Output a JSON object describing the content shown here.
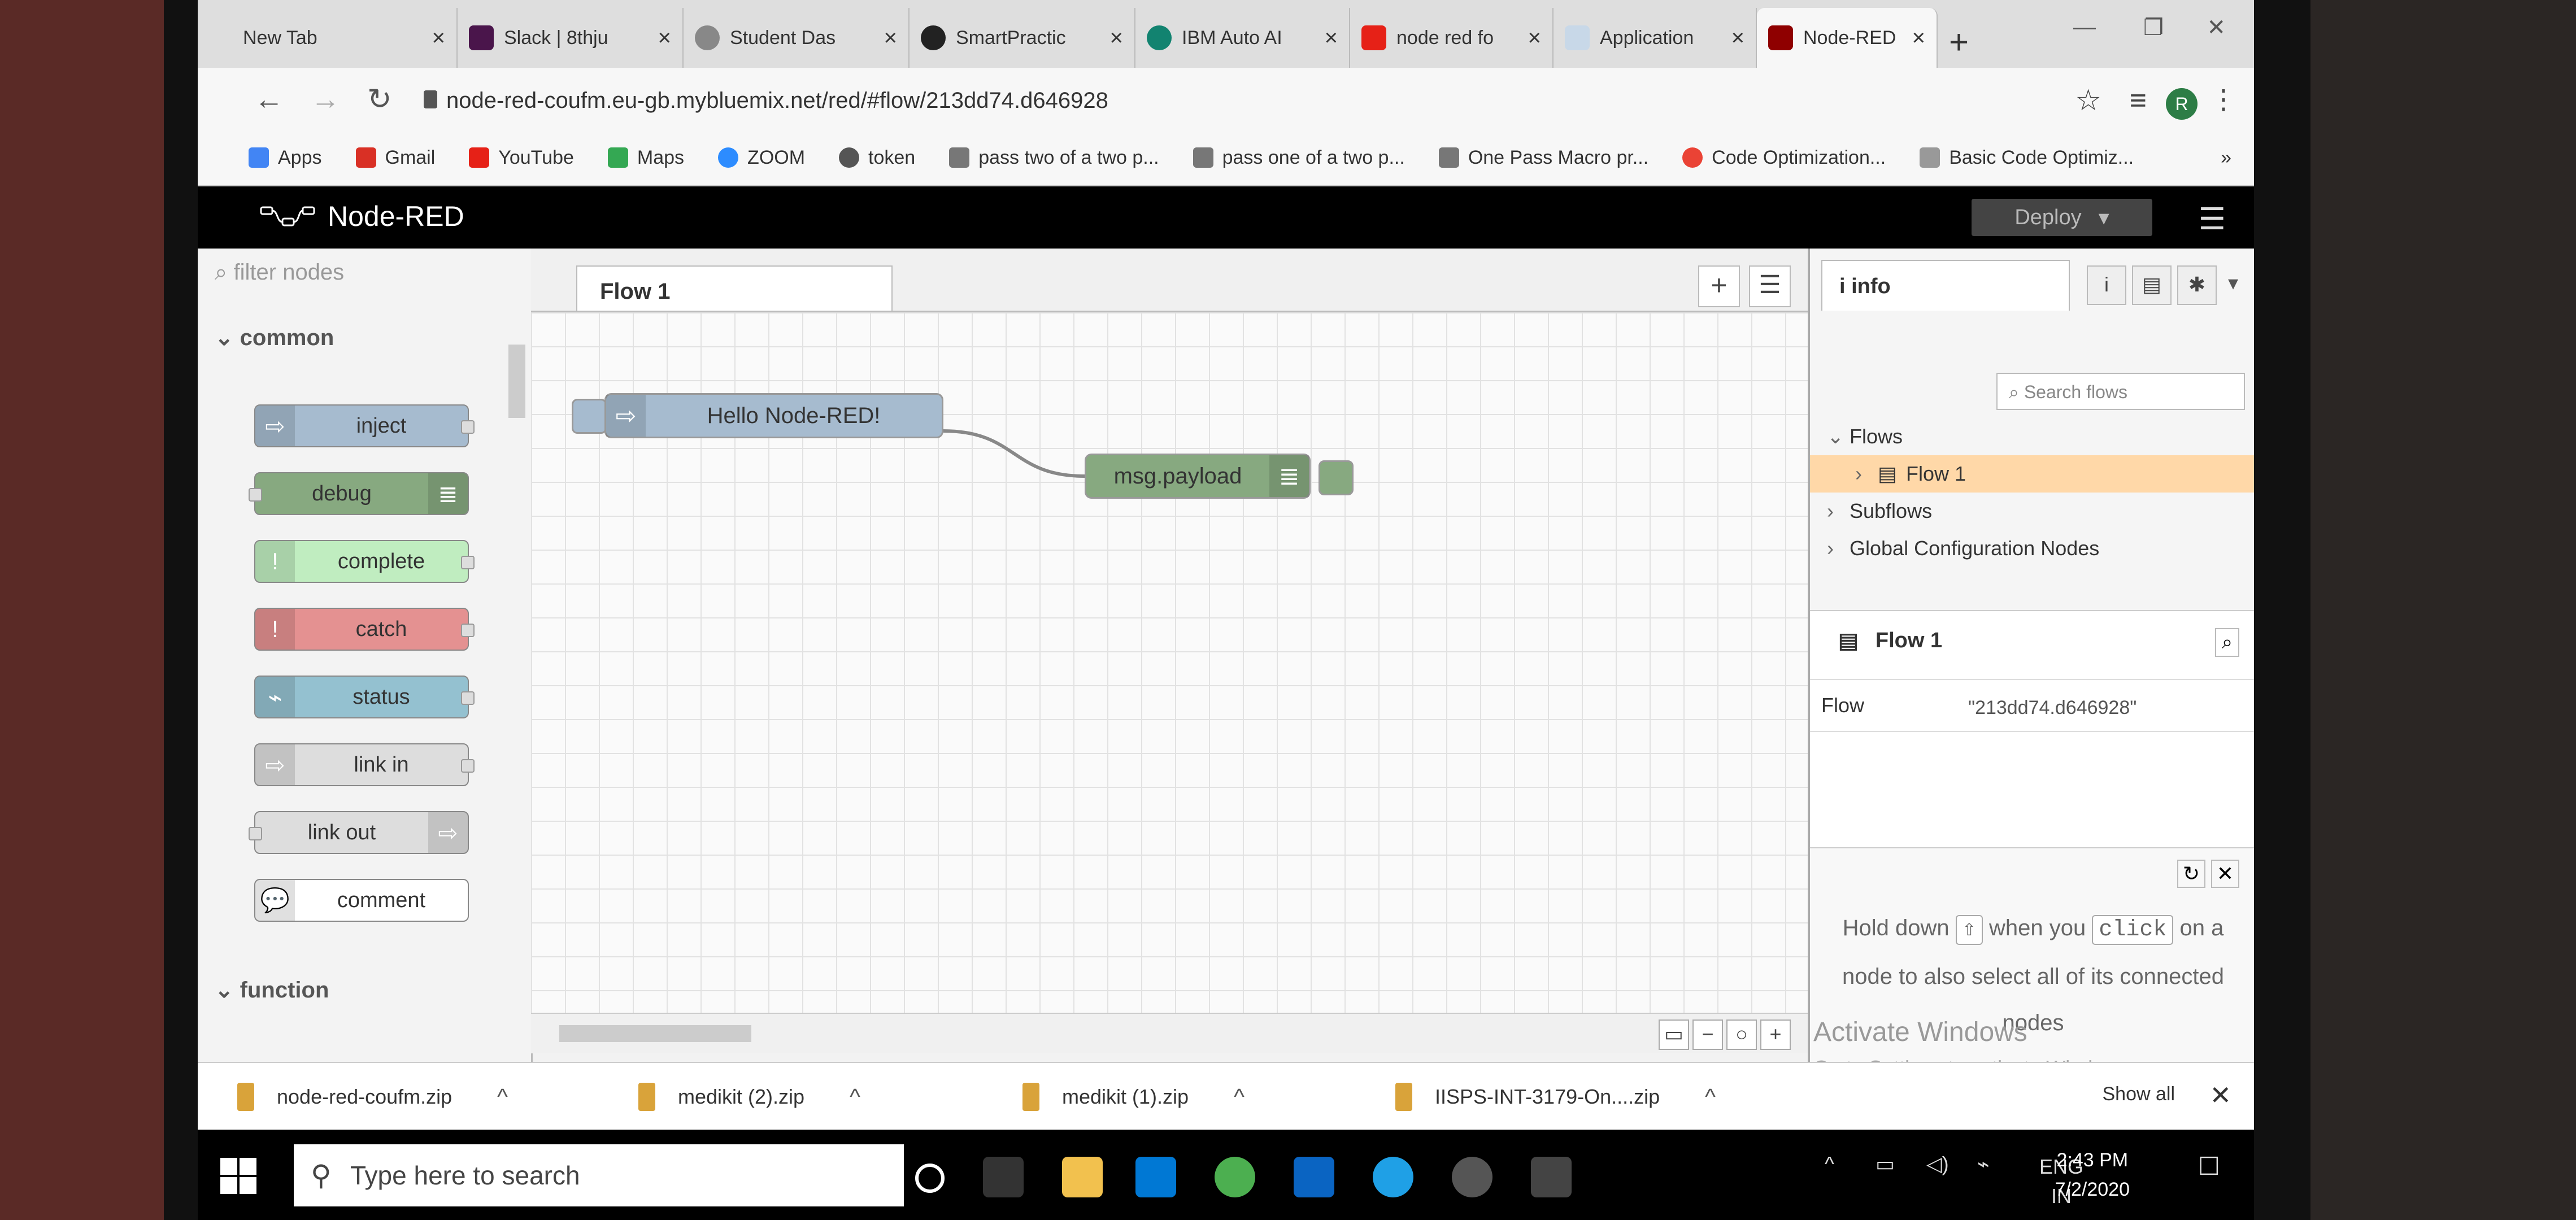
{
  "browser": {
    "tabs": [
      {
        "title": "New Tab",
        "color": "#f0f0f0"
      },
      {
        "title": "Slack | 8thju",
        "color": "#4a154b"
      },
      {
        "title": "Student Das",
        "color": "#888888"
      },
      {
        "title": "SmartPractic",
        "color": "#222222"
      },
      {
        "title": "IBM Auto AI",
        "color": "#128370"
      },
      {
        "title": "node red fo",
        "color": "#e62117"
      },
      {
        "title": "Application",
        "color": "#c8d8e8"
      },
      {
        "title": "Node-RED",
        "color": "#8f0000"
      }
    ],
    "close_glyph": "×",
    "new_tab_glyph": "+",
    "url": "node-red-coufm.eu-gb.mybluemix.net/red/#flow/213dd74.d646928",
    "profile_initial": "R",
    "bookmarks": [
      {
        "label": "Apps",
        "icon": "apps-grid-icon"
      },
      {
        "label": "Gmail",
        "icon": "gmail-icon"
      },
      {
        "label": "YouTube",
        "icon": "youtube-icon"
      },
      {
        "label": "Maps",
        "icon": "maps-icon"
      },
      {
        "label": "ZOOM",
        "icon": "zoom-icon"
      },
      {
        "label": "token",
        "icon": "token-icon"
      },
      {
        "label": "pass two of a two p...",
        "icon": "fc-icon"
      },
      {
        "label": "pass one of a two p...",
        "icon": "fc-icon"
      },
      {
        "label": "One Pass Macro pr...",
        "icon": "fc-icon"
      },
      {
        "label": "Code Optimization...",
        "icon": "map-pin-icon"
      },
      {
        "label": "Basic Code Optimiz...",
        "icon": "dg-icon"
      }
    ],
    "bookmarks_more": "»"
  },
  "nodered": {
    "brand": "Node-RED",
    "deploy_label": "Deploy",
    "palette": {
      "filter_placeholder": "filter nodes",
      "category_common": "common",
      "category_function": "function",
      "nodes": [
        {
          "label": "inject",
          "color": "#a6bbcf",
          "icon": "arrow-right-icon"
        },
        {
          "label": "debug",
          "color": "#87a980",
          "icon": "list-icon"
        },
        {
          "label": "complete",
          "color": "#c0edc0",
          "icon": "exclamation-icon"
        },
        {
          "label": "catch",
          "color": "#e49191",
          "icon": "exclamation-icon"
        },
        {
          "label": "status",
          "color": "#94c1d0",
          "icon": "pulse-icon"
        },
        {
          "label": "link in",
          "color": "#dddddd",
          "icon": "link-arrow-icon"
        },
        {
          "label": "link out",
          "color": "#dddddd",
          "icon": "link-arrow-icon"
        },
        {
          "label": "comment",
          "color": "#ffffff",
          "icon": "comment-icon"
        }
      ]
    },
    "workspace": {
      "tab_label": "Flow 1",
      "nodes": [
        {
          "label": "Hello Node-RED!",
          "color": "#a6bbcf"
        },
        {
          "label": "msg.payload",
          "color": "#87a980"
        }
      ]
    },
    "sidebar": {
      "tab_label": "info",
      "search_placeholder": "Search flows",
      "tree": {
        "flows": "Flows",
        "flow1": "Flow 1",
        "subflows": "Subflows",
        "global_config": "Global Configuration Nodes"
      },
      "details_title": "Flow 1",
      "details_key": "Flow",
      "details_value": "\"213dd74.d646928\"",
      "tip_part1": "Hold down",
      "tip_key1": "⇧",
      "tip_part2": "when you",
      "tip_key2": "click",
      "tip_part3": "on a node to also select all of its connected nodes"
    }
  },
  "windows_watermark": {
    "title": "Activate Windows",
    "subtitle": "Go to Settings to activate Windows."
  },
  "downloads": {
    "items": [
      {
        "name": "node-red-coufm.zip"
      },
      {
        "name": "medikit (2).zip"
      },
      {
        "name": "medikit (1).zip"
      },
      {
        "name": "IISPS-INT-3179-On....zip"
      }
    ],
    "show_all": "Show all"
  },
  "taskbar": {
    "search_placeholder": "Type here to search",
    "language": "ENG",
    "region": "IN",
    "time": "2:43 PM",
    "date": "7/2/2020"
  }
}
